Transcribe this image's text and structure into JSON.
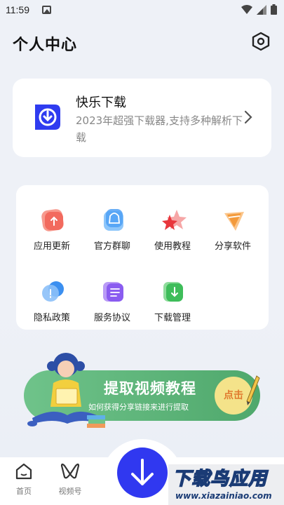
{
  "status_bar": {
    "time": "11:59"
  },
  "header": {
    "title": "个人中心"
  },
  "app_card": {
    "name": "快乐下载",
    "description": "2023年超强下载器,支持多种解析下载"
  },
  "grid": {
    "items": [
      {
        "label": "应用更新",
        "icon": "upload-icon",
        "color": "#f26a5e"
      },
      {
        "label": "官方群聊",
        "icon": "chat-bag-icon",
        "color": "#4fa0f5"
      },
      {
        "label": "使用教程",
        "icon": "star-icon",
        "color": "#e8363c"
      },
      {
        "label": "分享软件",
        "icon": "paper-plane-icon",
        "color": "#f39a3b"
      },
      {
        "label": "隐私政策",
        "icon": "info-bubble-icon",
        "color": "#3b8ff0"
      },
      {
        "label": "服务协议",
        "icon": "document-icon",
        "color": "#8a5cf0"
      },
      {
        "label": "下载管理",
        "icon": "download-icon",
        "color": "#3ebd5a"
      }
    ]
  },
  "banner": {
    "title": "提取视频教程",
    "subtitle": "如何获得分享链接来进行提取",
    "button_label": "点击"
  },
  "bottom_nav": {
    "items": [
      {
        "label": "首页",
        "icon": "home-icon"
      },
      {
        "label": "视频号",
        "icon": "channels-icon"
      }
    ]
  },
  "watermark": {
    "title": "下载鸟应用",
    "url": "www.xiazainiao.com"
  },
  "colors": {
    "accent": "#3038f0",
    "banner_green": "#5bb679",
    "background": "#eef1f7"
  }
}
